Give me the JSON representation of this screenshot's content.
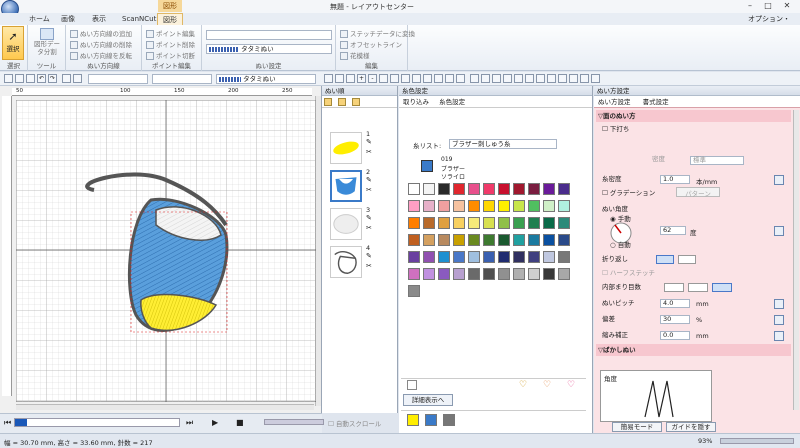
{
  "window": {
    "title": "無題 - レイアウトセンター",
    "context_tab": "図形",
    "options_label": "オプション・"
  },
  "tabs": [
    "ホーム",
    "画像",
    "表示",
    "ScanNCut",
    "図形"
  ],
  "ribbon": {
    "select_label": "選択",
    "select_group": "選択",
    "tool_btn": "図形データ分割",
    "tool_group": "ツール",
    "stitch_dir": [
      "ぬい方向線の追加",
      "ぬい方向線の削除",
      "ぬい方向線を反転"
    ],
    "stitch_dir_group": "ぬい方向線",
    "point": [
      "ポイント編集",
      "ポイント削除",
      "ポイント切断"
    ],
    "point_group": "ポイント編集",
    "sew_combo_2": "タタミぬい",
    "sew_group": "ぬい設定",
    "edit": [
      "ステッチデータに変換",
      "オフセットライン",
      "花模様"
    ],
    "edit_group": "編集"
  },
  "toolbar": {
    "combo": "タタミぬい",
    "zoom": "100 %"
  },
  "canvas": {
    "ruler_marks": [
      "50",
      "100",
      "150",
      "200",
      "250"
    ]
  },
  "playbar": {
    "checkbox_label": "自動スクロール"
  },
  "status": {
    "text": "幅 = 30.70 mm, 高さ = 33.60 mm, 針数 = 217",
    "zoom": "93%"
  },
  "stitch_pane": {
    "title": "ぬい順",
    "items": [
      {
        "num": "1"
      },
      {
        "num": "2"
      },
      {
        "num": "3"
      },
      {
        "num": "4"
      }
    ]
  },
  "thread_pane": {
    "title": "糸色設定",
    "tabs": [
      "取り込み",
      "糸色設定"
    ],
    "list_label": "糸リスト:",
    "list_value": "ブラザー刺しゅう糸",
    "current_code": "019",
    "current_name1": "ブラザー",
    "current_name2": "ソライロ",
    "detail_btn": "詳細表示へ",
    "colors": [
      "#ffffff",
      "#f4f4f4",
      "#2a2a2a",
      "#e0262e",
      "#e8508c",
      "#f03a6a",
      "#c8102e",
      "#a0182e",
      "#7a1d40",
      "#6a1b9a",
      "#4a2c8c",
      "#ff9ec4",
      "#e7b1c9",
      "#f0a0a0",
      "#f6c2a0",
      "#ff8c00",
      "#ffd700",
      "#ffef00",
      "#c8e64b",
      "#50c060",
      "#d0f0c8",
      "#b0f0e0",
      "#ff7e00",
      "#b86a2a",
      "#e0a040",
      "#f8d060",
      "#f6ea7a",
      "#d8e050",
      "#90c048",
      "#3aa050",
      "#1f7f50",
      "#0a6a48",
      "#2b8a7a",
      "#c06020",
      "#d4a060",
      "#b88a60",
      "#c8a000",
      "#6a8a20",
      "#3e7a30",
      "#1a5a30",
      "#20a0a0",
      "#1a7aa0",
      "#0a50a0",
      "#2a4a8a",
      "#6a40a0",
      "#9050b0",
      "#1e90d0",
      "#4a78c8",
      "#a0c0e0",
      "#3a60b0",
      "#202c70",
      "#303060",
      "#404080",
      "#c0c8e0",
      "#787878",
      "#d070c0",
      "#c090e0",
      "#8a5ac0",
      "#b8a0d0",
      "#6a6a6a",
      "#505050",
      "#909090",
      "#b0b0b0",
      "#d0d0d0",
      "#383838",
      "#a8a8a8",
      "#8a8a8a"
    ],
    "bottom_swatches": [
      "#ffee00",
      "#3a7ac8",
      "#777777"
    ]
  },
  "settings": {
    "title": "ぬい方設定",
    "tabs": [
      "ぬい方設定",
      "書式設定"
    ],
    "section_fill": "▽面のぬい方",
    "underlay": "下打ち",
    "underlay_density_label": "密度",
    "underlay_density_value": "標準",
    "density_label": "糸密度",
    "density_value": "1.0",
    "density_unit": "本/mm",
    "gradation": "グラデーション",
    "pattern_btn": "パターン",
    "direction_label": "ぬい角度",
    "direction_manual": "手動",
    "direction_value": "62",
    "direction_unit": "度",
    "direction_auto": "自動",
    "turn_label": "折り返し",
    "halfstitch": "ハーフステッチ",
    "inner_label": "内部まり目数",
    "pitch_label": "ぬいピッチ",
    "pitch_value": "4.0",
    "pitch_unit": "mm",
    "offset_label": "偏差",
    "offset_value": "30",
    "offset_unit": "%",
    "comp_label": "縮み補正",
    "comp_value": "0.0",
    "comp_unit": "mm",
    "section_fade": "▽ばかしぬい",
    "preview_label": "角度",
    "simple_btn": "簡易モード",
    "guide_btn": "ガイドを隠す"
  }
}
